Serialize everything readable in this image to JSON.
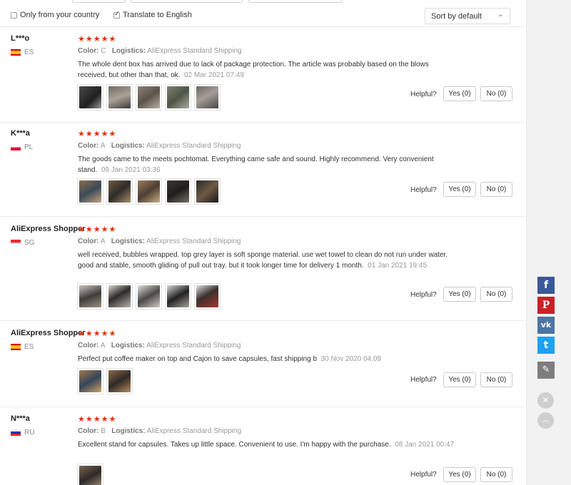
{
  "filters": {
    "only_country_label": "Only from your country",
    "translate_label": "Translate to English",
    "sort_value": "Sort by default"
  },
  "labels": {
    "color_prefix": "Color:",
    "logistics_prefix": "Logistics:",
    "helpful": "Helpful?"
  },
  "reviews": [
    {
      "user": "L***o",
      "country": "ES",
      "stars": "★★★★★",
      "color": "C",
      "logistics": "AliExpress Standard Shipping",
      "text": "The whole dent box has arrived due to lack of package protection. The article was probably based on the blows received, but other than that, ok.",
      "date": "02 Mar 2021 07:49",
      "yes": "Yes (0)",
      "no": "No (0)"
    },
    {
      "user": "K***a",
      "country": "PL",
      "stars": "★★★★★",
      "color": "A",
      "logistics": "AliExpress Standard Shipping",
      "text": "The goods came to the meets pochtomat. Everything came safe and sound. Highly recommend. Very convenient stand.",
      "date": "09 Jan 2021 03:36",
      "yes": "Yes (0)",
      "no": "No (0)"
    },
    {
      "user": "AliExpress Shopper",
      "country": "SG",
      "stars": "★★★★★",
      "color": "A",
      "logistics": "AliExpress Standard Shipping",
      "text": "well received, bubbles wrapped. top grey layer is soft sponge material. use wet towel to clean do not run under water. good and stable, smooth gliding of pull out tray. but it took longer time for delivery 1 month.",
      "date": "01 Jan 2021 19:45",
      "yes": "Yes (0)",
      "no": "No (0)"
    },
    {
      "user": "AliExpress Shopper",
      "country": "ES",
      "stars": "★★★★★",
      "color": "A",
      "logistics": "AliExpress Standard Shipping",
      "text": "Perfect put coffee maker on top and Cajon to save capsules, fast shipping b",
      "date": "30 Nov 2020 04:09",
      "yes": "Yes (0)",
      "no": "No (0)"
    },
    {
      "user": "N***a",
      "country": "RU",
      "stars": "★★★★★",
      "color": "B",
      "logistics": "AliExpress Standard Shipping",
      "text": "Excellent stand for capsules. Takes up little space. Convenient to use. I'm happy with the purchase.",
      "date": "08 Jan 2021 00:47",
      "yes": "Yes (0)",
      "no": "No (0)"
    }
  ],
  "colors": {
    "star": "#e62e04",
    "facebook": "#3b5998",
    "pinterest": "#cb2027",
    "vk": "#4c75a3",
    "twitter": "#1da1f2"
  },
  "social": {
    "facebook_glyph": "f",
    "pinterest_glyph": "P",
    "vk_glyph": "vk",
    "twitter_glyph": "t",
    "edit_glyph": "✎",
    "close_glyph": "✕",
    "up_glyph": "︿"
  }
}
